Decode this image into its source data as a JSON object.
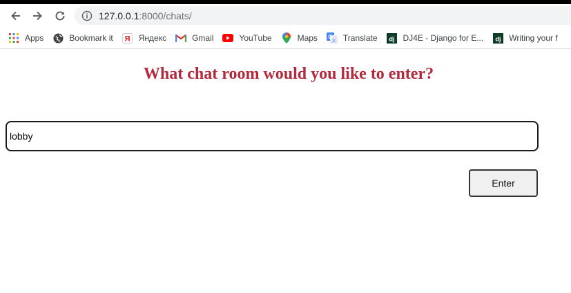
{
  "browser": {
    "url_host": "127.0.0.1",
    "url_port_path": ":8000/chats/",
    "nav_icons": [
      "back-arrow-icon",
      "forward-arrow-icon",
      "reload-icon",
      "info-icon"
    ],
    "bookmarks": [
      {
        "label": "Apps",
        "icon": "apps-grid-icon"
      },
      {
        "label": "Bookmark it",
        "icon": "globe-icon"
      },
      {
        "label": "Яндекс",
        "icon": "yandex-icon"
      },
      {
        "label": "Gmail",
        "icon": "gmail-icon"
      },
      {
        "label": "YouTube",
        "icon": "youtube-icon"
      },
      {
        "label": "Maps",
        "icon": "maps-pin-icon"
      },
      {
        "label": "Translate",
        "icon": "translate-icon"
      },
      {
        "label": "DJ4E - Django for E...",
        "icon": "dj-icon"
      },
      {
        "label": "Writing your f",
        "icon": "dj-icon"
      }
    ]
  },
  "page": {
    "heading": "What chat room would you like to enter?",
    "room_input_value": "lobby",
    "enter_button_label": "Enter",
    "heading_color": "#b22a3c"
  }
}
